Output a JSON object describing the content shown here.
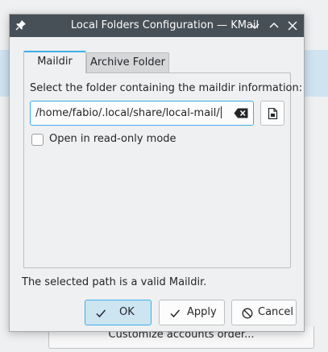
{
  "background": {
    "partial_button_label": "Customize accounts order..."
  },
  "window": {
    "title": "Local Folders Configuration — KMail",
    "controls": [
      "pin-icon",
      "minimize-icon",
      "maximize-icon",
      "close-icon"
    ]
  },
  "tabs": [
    {
      "label": "Maildir",
      "active": true
    },
    {
      "label": "Archive Folder",
      "active": false
    }
  ],
  "maildir": {
    "instruction": "Select the folder containing the maildir information:",
    "path_value": "/home/fabio/.local/share/local-mail/",
    "readonly_label": "Open in read-only mode",
    "readonly_checked": false
  },
  "status_message": "The selected path is a valid Maildir.",
  "buttons": {
    "ok": "OK",
    "apply": "Apply",
    "cancel": "Cancel"
  },
  "colors": {
    "accent": "#3daee9",
    "titlebar": "#475057",
    "window_bg": "#eff0f1"
  }
}
